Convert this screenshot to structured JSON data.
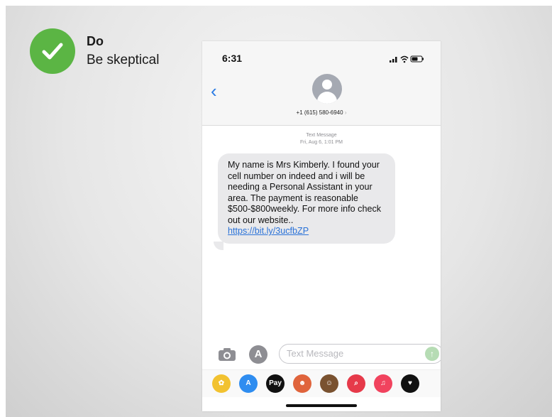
{
  "slide": {
    "do_title": "Do",
    "do_subtitle": "Be skeptical",
    "check_color": "#5bb544"
  },
  "phone": {
    "time": "6:31",
    "contact_number": "+1 (615) 580-6940",
    "contact_chevron": "›",
    "meta_line1": "Text Message",
    "meta_line2": "Fri, Aug 6, 1:01 PM",
    "message_text": "My name is Mrs Kimberly. I found your cell number on indeed and i will be needing a Personal Assistant in your area. The payment is reasonable $500-$800weekly. For more info check out our website..",
    "message_link": "https://bit.ly/3ucfbZP",
    "input_placeholder": "Text Message",
    "apps_icon_glyph": "A",
    "send_icon_glyph": "↑",
    "app_strip": [
      {
        "name": "photos-app-icon",
        "color": "#f2c230",
        "glyph": "✿"
      },
      {
        "name": "app-store-app-icon",
        "color": "#2f8df0",
        "glyph": "A"
      },
      {
        "name": "apple-pay-app-icon",
        "color": "#111111",
        "glyph": "Pay"
      },
      {
        "name": "memoji-app-icon",
        "color": "#e0643c",
        "glyph": "☻"
      },
      {
        "name": "animoji-app-icon",
        "color": "#7a5230",
        "glyph": "☺"
      },
      {
        "name": "images-search-app-icon",
        "color": "#e63a4a",
        "glyph": "⌕"
      },
      {
        "name": "music-app-icon",
        "color": "#f1435e",
        "glyph": "♫"
      },
      {
        "name": "more-app-icon",
        "color": "#111111",
        "glyph": "♥"
      }
    ]
  }
}
